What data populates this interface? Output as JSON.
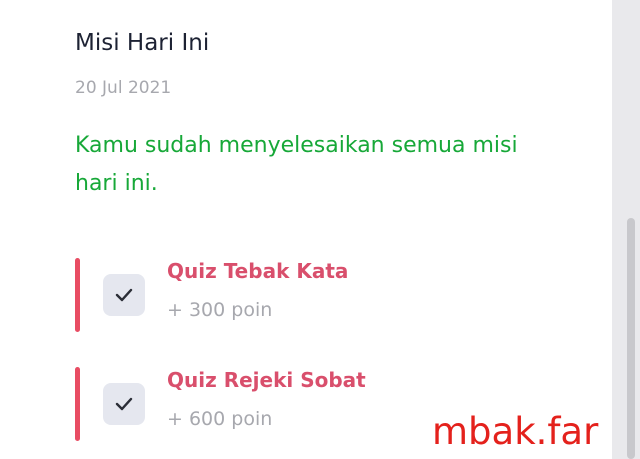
{
  "mission_panel": {
    "title": "Misi Hari Ini",
    "date": "20 Jul 2021",
    "completion_message": "Kamu sudah menyelesaikan semua misi hari ini."
  },
  "missions": [
    {
      "name": "Quiz Tebak Kata",
      "points": "+ 300 poin",
      "checked": true,
      "checkbox_icon": "check-icon"
    },
    {
      "name": "Quiz Rejeki Sobat",
      "points": "+ 600 poin",
      "checked": true,
      "checkbox_icon": "check-icon"
    }
  ],
  "watermark": {
    "text": "mbak.far"
  },
  "colors": {
    "title": "#1d2233",
    "date": "#a7a8ae",
    "success": "#17a838",
    "mission_name": "#d94f6c",
    "mission_bar": "#e84c63",
    "checkbox_bg": "#e5e7ef",
    "watermark": "#e4211c"
  }
}
